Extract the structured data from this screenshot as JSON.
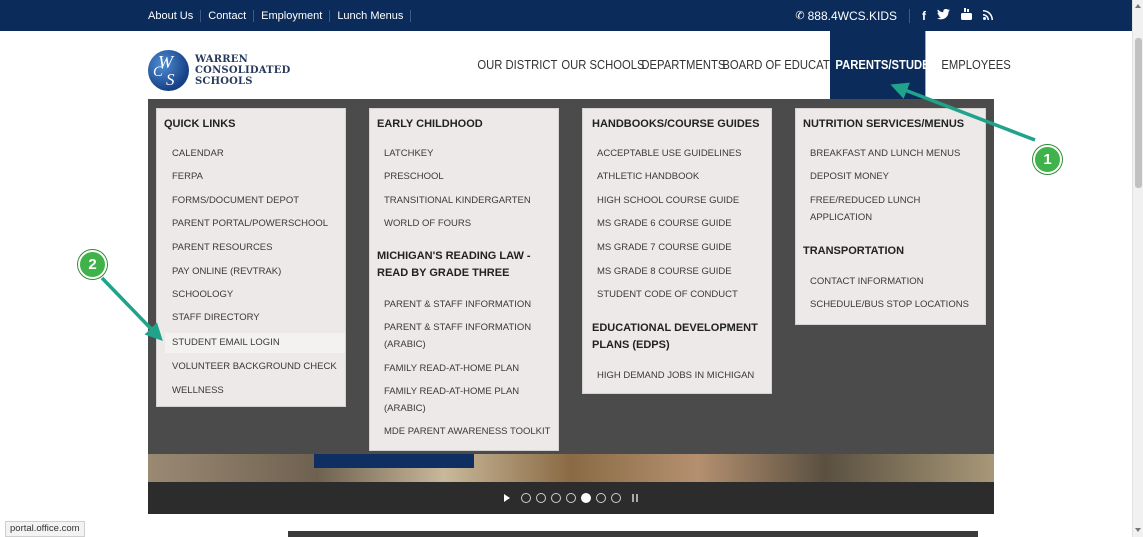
{
  "topbar": {
    "links": [
      "About Us",
      "Contact",
      "Employment",
      "Lunch Menus"
    ],
    "phone": "888.4WCS.KIDS",
    "social_icons": [
      "facebook-icon",
      "twitter-icon",
      "youtube-icon",
      "rss-icon"
    ],
    "social_glyphs": [
      "f",
      "t",
      "▶",
      "≋"
    ]
  },
  "logo": {
    "line1": "WARREN",
    "line2": "CONSOLIDATED",
    "line3": "SCHOOLS"
  },
  "nav": {
    "items": [
      "OUR DISTRICT",
      "OUR SCHOOLS",
      "DEPARTMENTS",
      "BOARD OF EDUCATION",
      "PARENTS/STUDENTS",
      "EMPLOYEES"
    ],
    "active": "PARENTS/STUDENTS"
  },
  "menu": {
    "quick_links": {
      "title": "QUICK LINKS",
      "items": [
        "CALENDAR",
        "FERPA",
        "FORMS/DOCUMENT DEPOT",
        "PARENT PORTAL/POWERSCHOOL",
        "PARENT RESOURCES",
        "PAY ONLINE (REVTRAK)",
        "SCHOOLOGY",
        "STAFF DIRECTORY",
        "STUDENT EMAIL LOGIN",
        "VOLUNTEER BACKGROUND CHECK",
        "WELLNESS"
      ]
    },
    "early_childhood": {
      "title": "EARLY CHILDHOOD",
      "items": [
        "LATCHKEY",
        "PRESCHOOL",
        "TRANSITIONAL KINDERGARTEN",
        "WORLD OF FOURS"
      ]
    },
    "reading_law": {
      "title_line1": "MICHIGAN'S READING LAW -",
      "title_line2": "READ BY GRADE THREE",
      "items": [
        "PARENT & STAFF INFORMATION",
        "PARENT & STAFF INFORMATION",
        "(ARABIC)",
        "FAMILY READ-AT-HOME PLAN",
        "FAMILY READ-AT-HOME PLAN",
        "(ARABIC)",
        "MDE PARENT AWARENESS TOOLKIT"
      ]
    },
    "handbooks": {
      "title": "HANDBOOKS/COURSE GUIDES",
      "items": [
        "ACCEPTABLE USE GUIDELINES",
        "ATHLETIC HANDBOOK",
        "HIGH SCHOOL COURSE GUIDE",
        "MS GRADE 6 COURSE GUIDE",
        "MS GRADE 7 COURSE GUIDE",
        "MS GRADE 8 COURSE GUIDE",
        "STUDENT CODE OF CONDUCT"
      ]
    },
    "edp": {
      "title_line1": "EDUCATIONAL DEVELOPMENT",
      "title_line2": "PLANS (EDPS)",
      "items": [
        "HIGH DEMAND JOBS IN MICHIGAN"
      ]
    },
    "nutrition": {
      "title": "NUTRITION SERVICES/MENUS",
      "items": [
        "BREAKFAST AND LUNCH MENUS",
        "DEPOSIT MONEY",
        "FREE/REDUCED LUNCH",
        "APPLICATION"
      ]
    },
    "transportation": {
      "title": "TRANSPORTATION",
      "items": [
        "CONTACT INFORMATION",
        "SCHEDULE/BUS STOP LOCATIONS"
      ]
    }
  },
  "slider": {
    "dots": 7,
    "active_dot": 5
  },
  "status_bar": "portal.office.com",
  "annotations": {
    "badge1": "1",
    "badge2": "2",
    "color": "#3fb24a",
    "arrow_color": "#1fa38a"
  },
  "colors": {
    "navy": "#0b2c5a",
    "menu_bg": "#4b4b4b",
    "column_bg": "#ece9e8"
  }
}
